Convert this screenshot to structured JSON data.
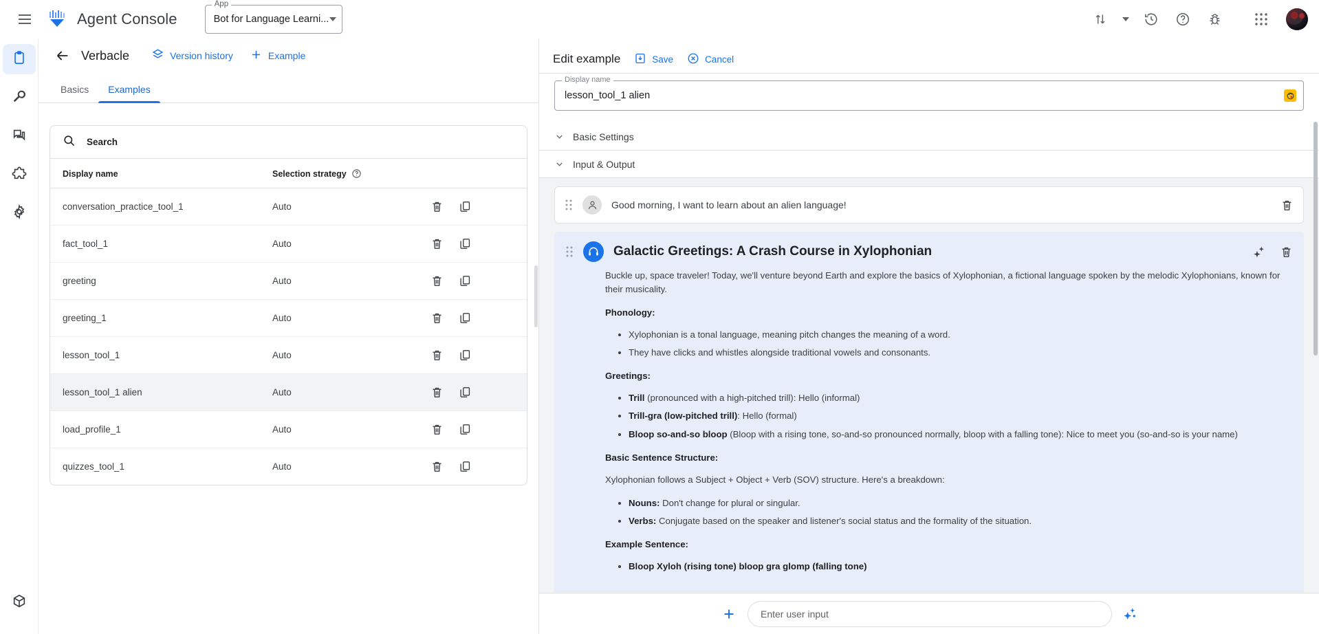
{
  "topbar": {
    "menu_icon": "hamburger-icon",
    "brand": "Agent Console",
    "app_field_label": "App",
    "app_field_value": "Bot for Language Learni...",
    "icons": [
      "sort-arrows-icon",
      "chevron-down-icon",
      "history-icon",
      "help-icon",
      "bug-report-icon",
      "apps-grid-icon",
      "avatar"
    ]
  },
  "rail": {
    "items": [
      {
        "name": "clipboard-icon",
        "active": true
      },
      {
        "name": "wrench-icon",
        "active": false
      },
      {
        "name": "chat-icon",
        "active": false
      },
      {
        "name": "puzzle-icon",
        "active": false
      },
      {
        "name": "gear-icon",
        "active": false
      }
    ],
    "bottom": {
      "name": "cube-icon"
    }
  },
  "left_panel": {
    "back_label": "back-arrow",
    "title": "Verbacle",
    "version_history_label": "Version history",
    "add_example_label": "Example",
    "tabs": [
      {
        "label": "Basics",
        "active": false
      },
      {
        "label": "Examples",
        "active": true
      }
    ],
    "search_placeholder": "Search",
    "table": {
      "headers": [
        "Display name",
        "Selection strategy"
      ],
      "help_tooltip": "?",
      "rows": [
        {
          "name": "conversation_practice_tool_1",
          "strategy": "Auto",
          "selected": false
        },
        {
          "name": "fact_tool_1",
          "strategy": "Auto",
          "selected": false
        },
        {
          "name": "greeting",
          "strategy": "Auto",
          "selected": false
        },
        {
          "name": "greeting_1",
          "strategy": "Auto",
          "selected": false
        },
        {
          "name": "lesson_tool_1",
          "strategy": "Auto",
          "selected": false
        },
        {
          "name": "lesson_tool_1 alien",
          "strategy": "Auto",
          "selected": true
        },
        {
          "name": "load_profile_1",
          "strategy": "Auto",
          "selected": false
        },
        {
          "name": "quizzes_tool_1",
          "strategy": "Auto",
          "selected": false
        }
      ]
    }
  },
  "right_panel": {
    "title": "Edit example",
    "save_label": "Save",
    "cancel_label": "Cancel",
    "display_name_label": "Display name",
    "display_name_value": "lesson_tool_1 alien",
    "accordions": [
      {
        "label": "Basic Settings"
      },
      {
        "label": "Input & Output"
      }
    ],
    "user_message": "Good morning, I want to learn about an alien language!",
    "bot": {
      "title": "Galactic Greetings: A Crash Course in Xylophonian",
      "intro": "Buckle up, space traveler! Today, we'll venture beyond Earth and explore the basics of Xylophonian, a fictional language spoken by the melodic Xylophonians, known for their musicality.",
      "phonology_heading": "Phonology:",
      "phonology_items": [
        "Xylophonian is a tonal language, meaning pitch changes the meaning of a word.",
        "They have clicks and whistles alongside traditional vowels and consonants."
      ],
      "greetings_heading": "Greetings:",
      "greetings_items": [
        {
          "bold": "Trill",
          "rest": " (pronounced with a high-pitched trill): Hello (informal)"
        },
        {
          "bold": "Trill-gra (low-pitched trill)",
          "rest": ": Hello (formal)"
        },
        {
          "bold": "Bloop so-and-so bloop",
          "rest": " (Bloop with a rising tone, so-and-so pronounced normally, bloop with a falling tone): Nice to meet you (so-and-so is your name)"
        }
      ],
      "structure_heading": "Basic Sentence Structure:",
      "structure_intro": "Xylophonian follows a Subject + Object + Verb (SOV) structure. Here's a breakdown:",
      "structure_items": [
        {
          "bold": "Nouns:",
          "rest": " Don't change for plural or singular."
        },
        {
          "bold": "Verbs:",
          "rest": " Conjugate based on the speaker and listener's social status and the formality of the situation."
        }
      ],
      "example_heading": "Example Sentence:",
      "example_items": [
        {
          "bold": "Bloop Xyloh (rising tone) bloop gra glomp (falling tone)",
          "rest": ""
        }
      ]
    },
    "composer_placeholder": "Enter user input"
  },
  "colors": {
    "accent": "#1a73e8",
    "bot_bubble": "#e8eef9",
    "selected_row": "#f1f3f4",
    "badge": "#fbbc04"
  }
}
